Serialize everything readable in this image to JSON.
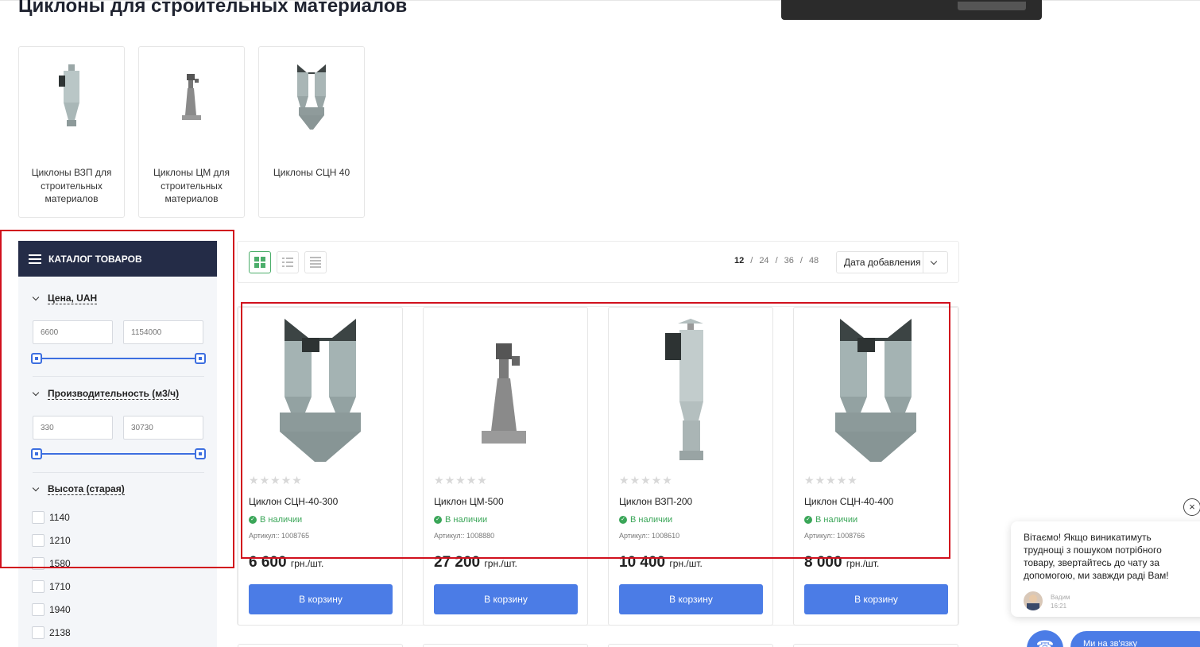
{
  "page": {
    "title": "Циклоны для строительных материалов"
  },
  "subcategories": [
    {
      "label": "Циклоны ВЗП для строительных материалов"
    },
    {
      "label": "Циклоны ЦМ для строительных материалов"
    },
    {
      "label": "Циклоны СЦН 40"
    }
  ],
  "catalog": {
    "header": "Каталог товаров",
    "filters": {
      "price": {
        "title": "Цена, UAH",
        "min_placeholder": "6600",
        "max_placeholder": "1154000"
      },
      "capacity": {
        "title": "Производительность (м3/ч)",
        "min_placeholder": "330",
        "max_placeholder": "30730"
      },
      "height": {
        "title": "Высота (старая)",
        "options": [
          "1140",
          "1210",
          "1580",
          "1710",
          "1940",
          "2138"
        ]
      }
    }
  },
  "toolbar": {
    "view_modes": [
      "grid-view-icon",
      "list-view-icon",
      "compact-list-icon"
    ],
    "per_page": {
      "options": [
        "12",
        "24",
        "36",
        "48"
      ],
      "separator": "/",
      "selected": "12"
    },
    "sort": {
      "selected": "Дата добавления"
    }
  },
  "products": [
    {
      "name": "Циклон СЦН-40-300",
      "stock": "В наличии",
      "sku": "Артикул:: 1008765",
      "price": "6 600",
      "unit": "грн./шт.",
      "button": "В корзину"
    },
    {
      "name": "Циклон ЦМ-500",
      "stock": "В наличии",
      "sku": "Артикул:: 1008880",
      "price": "27 200",
      "unit": "грн./шт.",
      "button": "В корзину"
    },
    {
      "name": "Циклон ВЗП-200",
      "stock": "В наличии",
      "sku": "Артикул:: 1008610",
      "price": "10 400",
      "unit": "грн./шт.",
      "button": "В корзину"
    },
    {
      "name": "Циклон СЦН-40-400",
      "stock": "В наличии",
      "sku": "Артикул:: 1008766",
      "price": "8 000",
      "unit": "грн./шт.",
      "button": "В корзину"
    }
  ],
  "chat": {
    "message": "Вітаємо! Якщо виникатиму­ть труднощі з пошуком потрібного товару, звертайтесь до чату за допомогою, ми завжди раді Вам!",
    "author": "Вадим",
    "time": "16:21",
    "close": "×",
    "status": "Ми на зв'язку"
  },
  "colors": {
    "accent": "#4b7ce6",
    "catalog_header": "#242c47",
    "in_stock": "#3aa658",
    "highlight": "#d1101d"
  }
}
